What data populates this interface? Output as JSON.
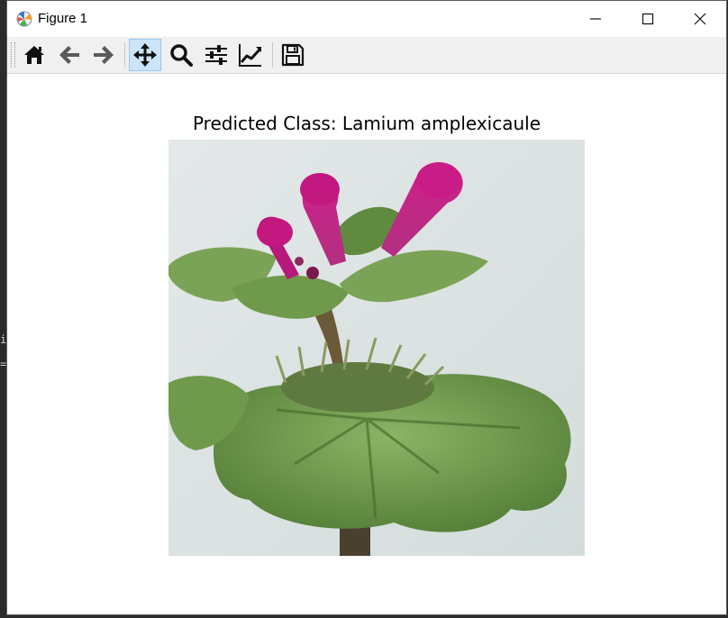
{
  "window": {
    "title": "Figure 1",
    "controls": {
      "minimize": "minimize-icon",
      "maximize": "maximize-icon",
      "close": "close-icon"
    }
  },
  "toolbar": {
    "buttons": [
      {
        "id": "home",
        "icon": "home-icon"
      },
      {
        "id": "back",
        "icon": "arrow-left-icon"
      },
      {
        "id": "forward",
        "icon": "arrow-right-icon"
      },
      {
        "id": "pan",
        "icon": "move-icon",
        "active": true
      },
      {
        "id": "zoom",
        "icon": "magnifier-icon"
      },
      {
        "id": "subplots",
        "icon": "sliders-icon"
      },
      {
        "id": "customize",
        "icon": "line-chart-icon"
      },
      {
        "id": "save",
        "icon": "floppy-disk-icon"
      }
    ]
  },
  "figure": {
    "title": "Predicted Class: Lamium amplexicaule",
    "image": {
      "subject": "plant-photo"
    }
  },
  "background_terminal": {
    "lines": [
      "i",
      "="
    ]
  },
  "colors": {
    "toolbar_bg": "#f0f0f0",
    "active_button_bg": "#cce4f7",
    "window_bg": "#ffffff",
    "flower_magenta": "#c2187f",
    "leaf_green": "#6f9a4c"
  }
}
